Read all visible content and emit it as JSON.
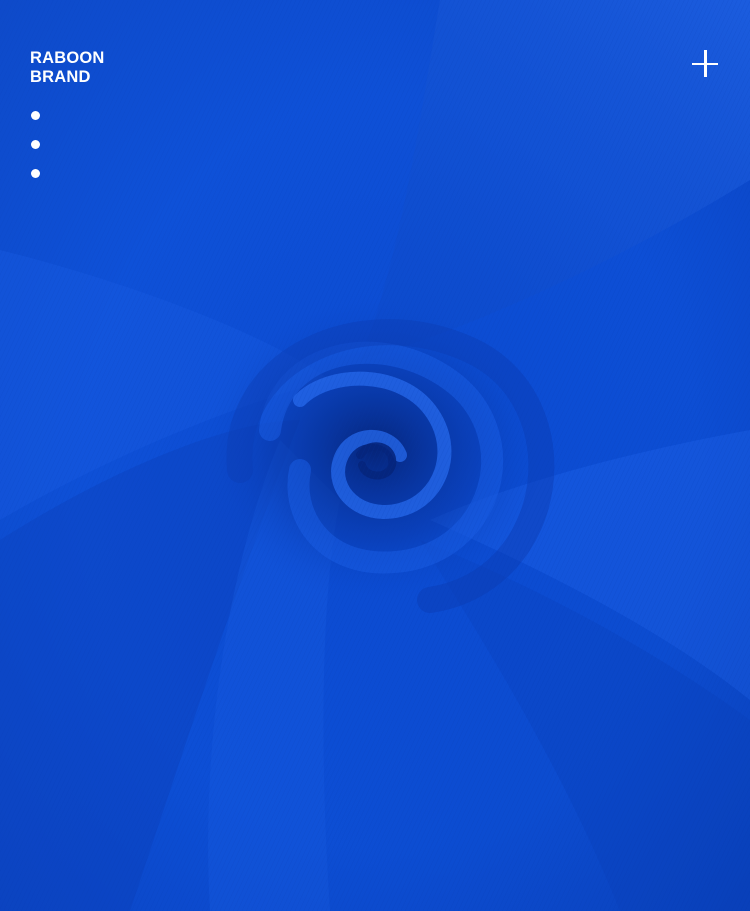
{
  "brand": {
    "line1": "RABOON",
    "line2": "BRAND"
  },
  "decor": {
    "dot_count": 3,
    "plus_icon": "plus-icon"
  },
  "colors": {
    "fabric_base": "#0a48c9",
    "fabric_highlight": "#1f63e6",
    "fabric_shadow": "#062a86",
    "text": "#ffffff"
  }
}
